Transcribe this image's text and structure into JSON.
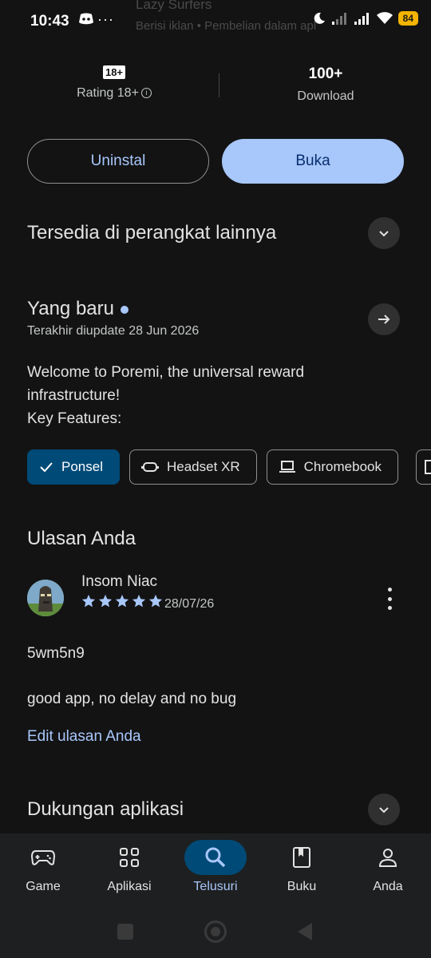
{
  "status_bar": {
    "time": "10:43",
    "dots": "···",
    "battery": "84"
  },
  "app_header_behind": {
    "developer": "Lazy Surfers",
    "meta": "Berisi iklan • Pembelian dalam apl"
  },
  "stats": {
    "rating_badge": "18+",
    "rating_label": "Rating 18+",
    "downloads_value": "100+",
    "downloads_label": "Download"
  },
  "actions": {
    "uninstall_label": "Uninstal",
    "open_label": "Buka"
  },
  "other_devices": {
    "title": "Tersedia di perangkat lainnya"
  },
  "whats_new": {
    "title": "Yang baru",
    "updated": "Terakhir diupdate 28 Jun 2026",
    "description_lines": [
      "Welcome to Poremi, the universal reward",
      "infrastructure!",
      "Key Features:"
    ]
  },
  "device_chips": [
    {
      "label": "Ponsel",
      "icon": "check-icon",
      "selected": true
    },
    {
      "label": "Headset XR",
      "icon": "headset-xr-icon",
      "selected": false
    },
    {
      "label": "Chromebook",
      "icon": "laptop-icon",
      "selected": false
    }
  ],
  "your_review": {
    "title": "Ulasan Anda",
    "reviewer": "Insom Niac",
    "stars": 5,
    "date": "28/07/26",
    "line1": "5wm5n9",
    "line2": "good app, no delay and no bug",
    "edit_label": "Edit ulasan Anda"
  },
  "app_support": {
    "title": "Dukungan aplikasi"
  },
  "bottom_nav": {
    "items": [
      {
        "label": "Game",
        "icon": "gamepad-icon"
      },
      {
        "label": "Aplikasi",
        "icon": "apps-grid-icon"
      },
      {
        "label": "Telusuri",
        "icon": "search-icon",
        "active": true
      },
      {
        "label": "Buku",
        "icon": "book-icon"
      },
      {
        "label": "Anda",
        "icon": "person-icon"
      }
    ]
  },
  "colors": {
    "background": "#131314",
    "accent": "#a8c7fa",
    "chip_selected": "#004a77",
    "battery": "#f4b400"
  }
}
